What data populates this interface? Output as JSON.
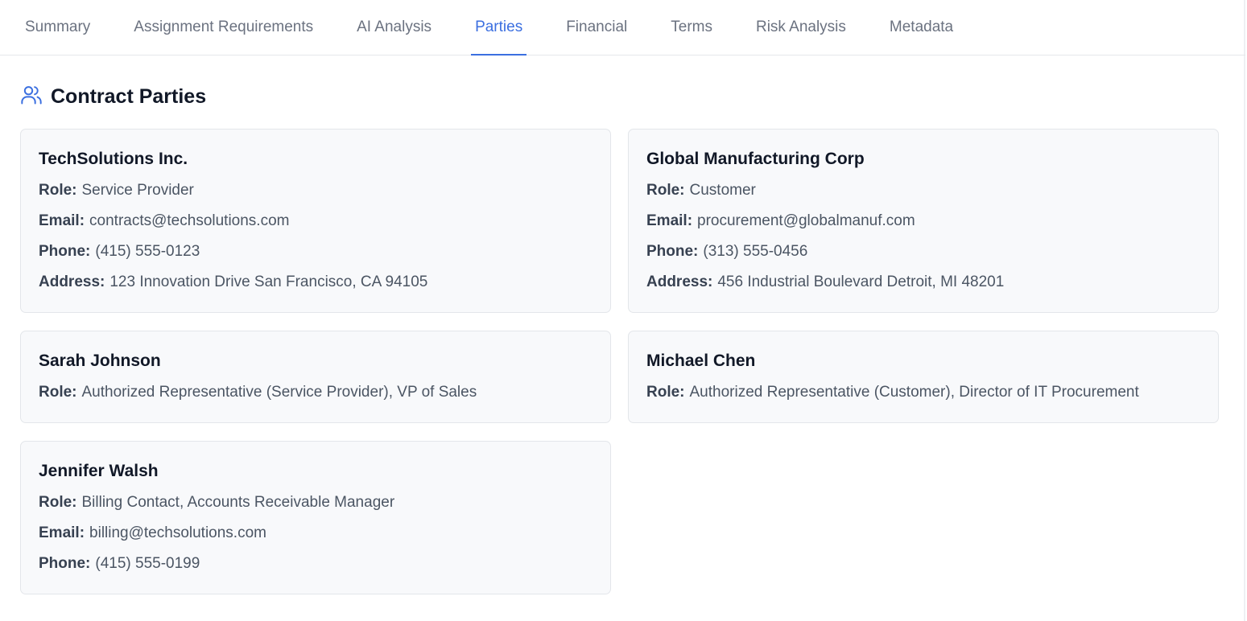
{
  "tabs": [
    {
      "label": "Summary",
      "active": false
    },
    {
      "label": "Assignment Requirements",
      "active": false
    },
    {
      "label": "AI Analysis",
      "active": false
    },
    {
      "label": "Parties",
      "active": true
    },
    {
      "label": "Financial",
      "active": false
    },
    {
      "label": "Terms",
      "active": false
    },
    {
      "label": "Risk Analysis",
      "active": false
    },
    {
      "label": "Metadata",
      "active": false
    }
  ],
  "section": {
    "title": "Contract Parties",
    "icon": "users-icon"
  },
  "labels": {
    "role": "Role:",
    "email": "Email:",
    "phone": "Phone:",
    "address": "Address:"
  },
  "parties": [
    {
      "name": "TechSolutions Inc.",
      "role": "Service Provider",
      "email": "contracts@techsolutions.com",
      "phone": "(415) 555-0123",
      "address": "123 Innovation Drive San Francisco, CA 94105"
    },
    {
      "name": "Global Manufacturing Corp",
      "role": "Customer",
      "email": "procurement@globalmanuf.com",
      "phone": "(313) 555-0456",
      "address": "456 Industrial Boulevard Detroit, MI 48201"
    },
    {
      "name": "Sarah Johnson",
      "role": "Authorized Representative (Service Provider), VP of Sales"
    },
    {
      "name": "Michael Chen",
      "role": "Authorized Representative (Customer), Director of IT Procurement"
    },
    {
      "name": "Jennifer Walsh",
      "role": "Billing Contact, Accounts Receivable Manager",
      "email": "billing@techsolutions.com",
      "phone": "(415) 555-0199"
    }
  ],
  "colors": {
    "accent": "#3b6fe0",
    "card_bg": "#f8f9fb",
    "border": "#e3e6ea",
    "muted_text": "#6b7280"
  }
}
